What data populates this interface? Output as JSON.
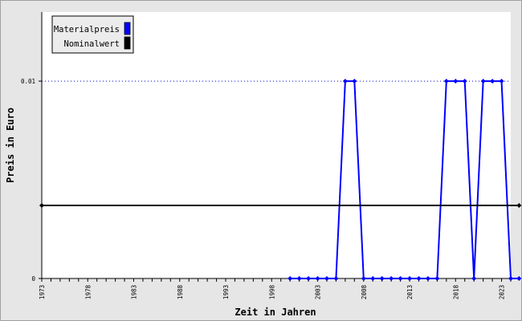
{
  "chart_data": {
    "type": "line",
    "title": "",
    "xlabel": "Zeit in Jahren",
    "ylabel": "Preis in Euro",
    "ylim": [
      0,
      0.0135
    ],
    "xlim": [
      1973,
      2024
    ],
    "y_ticks": [
      {
        "value": 0,
        "label": "0"
      },
      {
        "value": 0.01,
        "label": "0.01"
      }
    ],
    "x_tick_labels": [
      "1973",
      "1978",
      "1983",
      "1988",
      "1993",
      "1998",
      "2003",
      "2008",
      "2013",
      "2018",
      "2023"
    ],
    "grid": "dotted horizontal line at 0.01",
    "legend": {
      "placement": "top-left"
    },
    "series": [
      {
        "name": "Materialpreis",
        "color": "#0000ff",
        "points": [
          {
            "x": 2000,
            "y": 0
          },
          {
            "x": 2001,
            "y": 0
          },
          {
            "x": 2002,
            "y": 0
          },
          {
            "x": 2003,
            "y": 0
          },
          {
            "x": 2004,
            "y": 0
          },
          {
            "x": 2005,
            "y": 0
          },
          {
            "x": 2006,
            "y": 0.01
          },
          {
            "x": 2007,
            "y": 0.01
          },
          {
            "x": 2008,
            "y": 0
          },
          {
            "x": 2009,
            "y": 0
          },
          {
            "x": 2010,
            "y": 0
          },
          {
            "x": 2011,
            "y": 0
          },
          {
            "x": 2012,
            "y": 0
          },
          {
            "x": 2013,
            "y": 0
          },
          {
            "x": 2014,
            "y": 0
          },
          {
            "x": 2015,
            "y": 0
          },
          {
            "x": 2016,
            "y": 0
          },
          {
            "x": 2017,
            "y": 0.01
          },
          {
            "x": 2018,
            "y": 0.01
          },
          {
            "x": 2019,
            "y": 0.01
          },
          {
            "x": 2020,
            "y": 0
          },
          {
            "x": 2021,
            "y": 0.01
          },
          {
            "x": 2022,
            "y": 0.01
          },
          {
            "x": 2023,
            "y": 0.01
          },
          {
            "x": 2024,
            "y": 0
          },
          {
            "x": 2024.9,
            "y": 0
          }
        ]
      },
      {
        "name": "Nominalwert",
        "color": "#000000",
        "points": [
          {
            "x": 1973,
            "y": 0.0037
          },
          {
            "x": 2024.9,
            "y": 0.0037
          }
        ]
      }
    ]
  }
}
